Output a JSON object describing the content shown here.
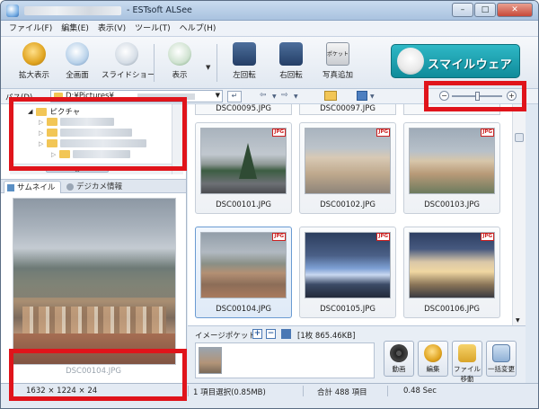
{
  "window": {
    "title": "- ESTsoft ALSee",
    "controls": {
      "minimize": "–",
      "maximize": "□",
      "close": "✕"
    }
  },
  "menu": [
    {
      "label": "ファイル(F)"
    },
    {
      "label": "編集(E)"
    },
    {
      "label": "表示(V)"
    },
    {
      "label": "ツール(T)"
    },
    {
      "label": "ヘルプ(H)"
    }
  ],
  "toolbar": {
    "buttons": [
      {
        "label": "拡大表示",
        "icon": "zoom-mascot-icon"
      },
      {
        "label": "全画面",
        "icon": "fullscreen-mascot-icon"
      },
      {
        "label": "スライドショー",
        "icon": "slideshow-mascot-icon"
      },
      {
        "label": "表示",
        "icon": "view-mascot-icon"
      },
      {
        "label": "左回転",
        "icon": "rotate-left-icon"
      },
      {
        "label": "右回転",
        "icon": "rotate-right-icon"
      },
      {
        "label": "写真追加",
        "icon": "add-photo-icon"
      }
    ],
    "pocket_badge": "ポケット",
    "banner_text": "スマイルウェア"
  },
  "address": {
    "label": "パス(D)",
    "path": "D:¥Pictures¥"
  },
  "tree": {
    "root_label": "ピクチャ",
    "hscroll_mark": "III"
  },
  "tabs": {
    "thumbnail": "サムネイル",
    "exif": "デジカメ情報"
  },
  "preview": {
    "caption": "DSC00104.JPG"
  },
  "thumbnails": {
    "partial_top": [
      "DSC00095.JPG",
      "DSC00097.JPG",
      ""
    ],
    "items": [
      {
        "name": "DSC00101.JPG",
        "badge": "JPG",
        "selected": false
      },
      {
        "name": "DSC00102.JPG",
        "badge": "JPG",
        "selected": false
      },
      {
        "name": "DSC00103.JPG",
        "badge": "JPG",
        "selected": false
      },
      {
        "name": "DSC00104.JPG",
        "badge": "JPG",
        "selected": true
      },
      {
        "name": "DSC00105.JPG",
        "badge": "JPG",
        "selected": false
      },
      {
        "name": "DSC00106.JPG",
        "badge": "JPG",
        "selected": false
      }
    ]
  },
  "pocket": {
    "label": "イメージポケット。",
    "add": "+",
    "remove": "−",
    "count_info": "[1枚 865.46KB]",
    "actions": [
      {
        "label": "動画",
        "icon": "film-reel-icon"
      },
      {
        "label": "編集",
        "icon": "edit-mascot-icon"
      },
      {
        "label": "ファイル移動",
        "icon": "file-move-icon"
      },
      {
        "label": "一括変更",
        "icon": "batch-change-icon"
      }
    ]
  },
  "status": {
    "dimensions": "1632 × 1224 × 24",
    "selection": "1 項目選択(0.85MB)",
    "total": "合計 488 項目",
    "time": "0.48 Sec"
  },
  "colors": {
    "highlight_box": "#e0141b",
    "banner": "#1aa2b2"
  }
}
